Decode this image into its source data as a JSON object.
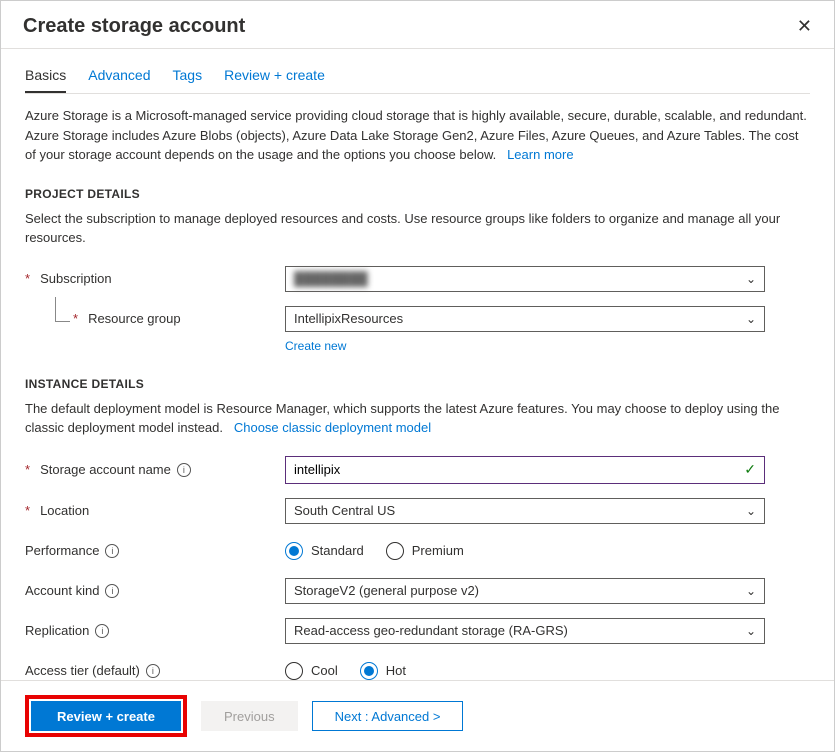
{
  "header": {
    "title": "Create storage account"
  },
  "tabs": [
    {
      "label": "Basics",
      "active": true
    },
    {
      "label": "Advanced",
      "active": false
    },
    {
      "label": "Tags",
      "active": false
    },
    {
      "label": "Review + create",
      "active": false
    }
  ],
  "intro": {
    "text": "Azure Storage is a Microsoft-managed service providing cloud storage that is highly available, secure, durable, scalable, and redundant. Azure Storage includes Azure Blobs (objects), Azure Data Lake Storage Gen2, Azure Files, Azure Queues, and Azure Tables. The cost of your storage account depends on the usage and the options you choose below.",
    "learn_more": "Learn more"
  },
  "project_details": {
    "title": "PROJECT DETAILS",
    "desc": "Select the subscription to manage deployed resources and costs. Use resource groups like folders to organize and manage all your resources.",
    "subscription": {
      "label": "Subscription",
      "value": ""
    },
    "resource_group": {
      "label": "Resource group",
      "value": "IntellipixResources",
      "create_new": "Create new"
    }
  },
  "instance_details": {
    "title": "INSTANCE DETAILS",
    "desc": "The default deployment model is Resource Manager, which supports the latest Azure features. You may choose to deploy using the classic deployment model instead.",
    "choose_classic": "Choose classic deployment model",
    "storage_account_name": {
      "label": "Storage account name",
      "value": "intellipix"
    },
    "location": {
      "label": "Location",
      "value": "South Central US"
    },
    "performance": {
      "label": "Performance",
      "options": [
        {
          "label": "Standard",
          "selected": true
        },
        {
          "label": "Premium",
          "selected": false
        }
      ]
    },
    "account_kind": {
      "label": "Account kind",
      "value": "StorageV2 (general purpose v2)"
    },
    "replication": {
      "label": "Replication",
      "value": "Read-access geo-redundant storage (RA-GRS)"
    },
    "access_tier": {
      "label": "Access tier (default)",
      "options": [
        {
          "label": "Cool",
          "selected": false
        },
        {
          "label": "Hot",
          "selected": true
        }
      ]
    }
  },
  "footer": {
    "review_create": "Review + create",
    "previous": "Previous",
    "next": "Next : Advanced >"
  }
}
